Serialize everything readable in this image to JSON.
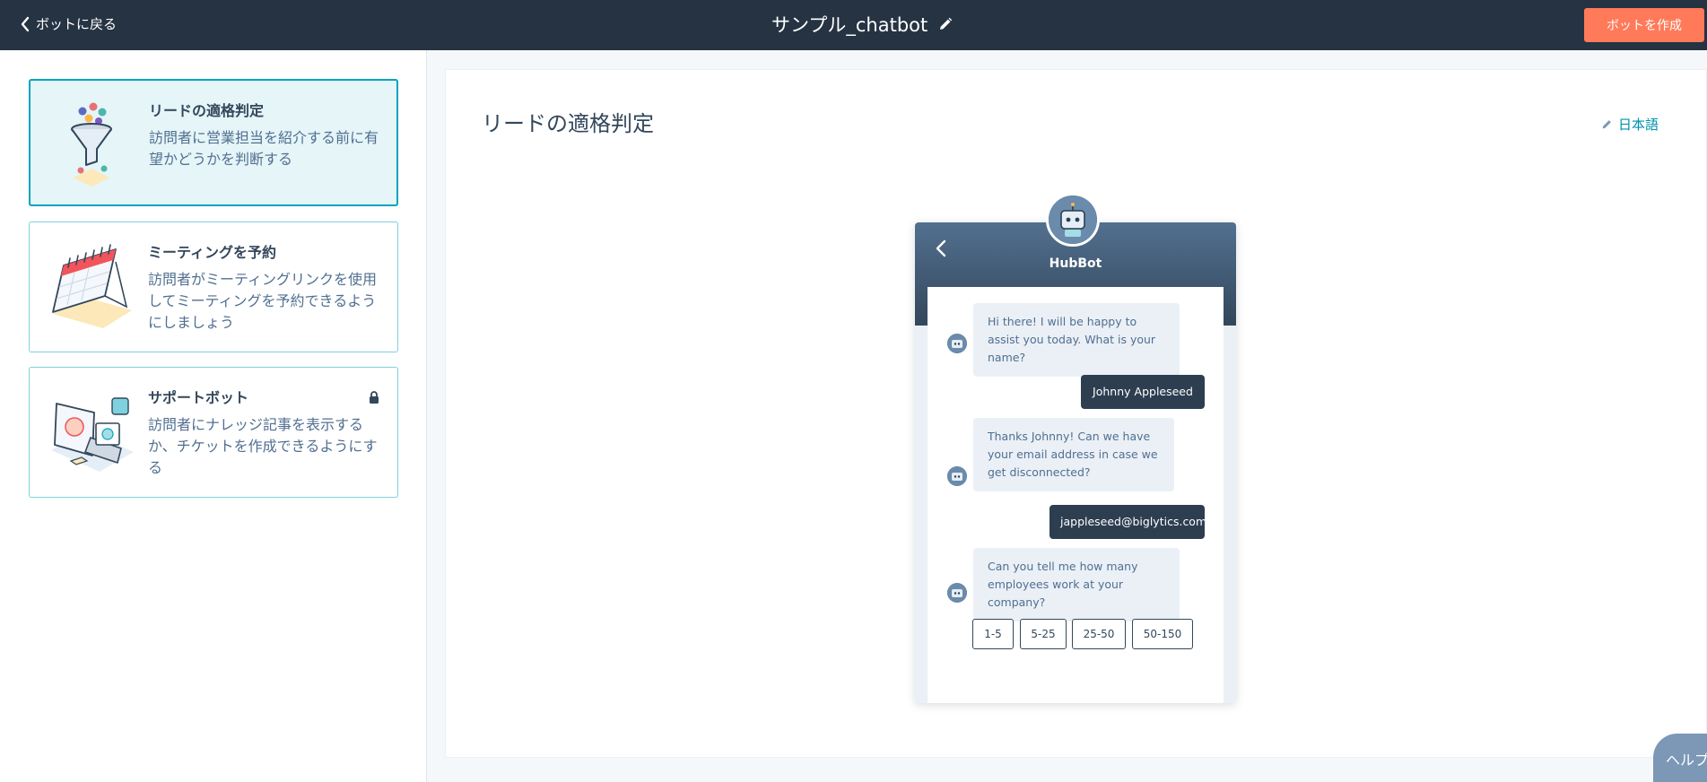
{
  "header": {
    "back_label": "ボットに戻る",
    "title": "サンプル_chatbot",
    "create_label": "ボットを作成"
  },
  "templates": [
    {
      "title": "リードの適格判定",
      "description": "訪問者に営業担当を紹介する前に有望かどうかを判断する",
      "selected": true,
      "locked": false
    },
    {
      "title": "ミーティングを予約",
      "description": "訪問者がミーティングリンクを使用してミーティングを予約できるようにしましょう",
      "selected": false,
      "locked": false
    },
    {
      "title": "サポートボット",
      "description": "訪問者にナレッジ記事を表示するか、チケットを作成できるようにする",
      "selected": false,
      "locked": true
    }
  ],
  "main": {
    "title": "リードの適格判定",
    "language_label": "日本語"
  },
  "chat": {
    "bot_name": "HubBot",
    "messages": [
      {
        "from": "bot",
        "text": "Hi there! I will be happy to assist you today. What is your name?"
      },
      {
        "from": "user",
        "text": "Johnny Appleseed"
      },
      {
        "from": "bot",
        "text": "Thanks Johnny! Can we have your email address in case we get disconnected?"
      },
      {
        "from": "user",
        "text": "jappleseed@biglytics.com"
      },
      {
        "from": "bot",
        "text": "Can you tell me how many employees work at your company?"
      }
    ],
    "options": [
      "1-5",
      "5-25",
      "25-50",
      "50-150"
    ]
  },
  "help_label": "ヘルプ",
  "colors": {
    "topbar": "#253342",
    "accent_orange": "#ff7a59",
    "selected_border": "#00a4bd",
    "selected_bg": "#e5f5f8",
    "link": "#0091ae",
    "user_bubble": "#2d3e50"
  }
}
